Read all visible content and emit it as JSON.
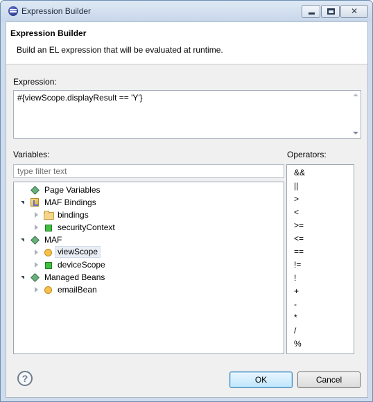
{
  "window": {
    "title": "Expression Builder"
  },
  "header": {
    "title": "Expression Builder",
    "description": "Build an EL expression that will be evaluated at runtime."
  },
  "expression": {
    "label": "Expression:",
    "value": "#{viewScope.displayResult == 'Y'}"
  },
  "variables": {
    "label": "Variables:",
    "filter_placeholder": "type filter text",
    "tree": [
      {
        "label": "Page Variables",
        "icon": "diamond-icon",
        "state": "leaf"
      },
      {
        "label": "MAF Bindings",
        "icon": "maf-icon",
        "state": "expanded"
      },
      {
        "label": "bindings",
        "icon": "folder-icon",
        "state": "collapsed"
      },
      {
        "label": "securityContext",
        "icon": "green-square-icon",
        "state": "collapsed"
      },
      {
        "label": "MAF",
        "icon": "diamond-icon",
        "state": "expanded"
      },
      {
        "label": "viewScope",
        "icon": "bean-icon",
        "state": "collapsed",
        "selected": true
      },
      {
        "label": "deviceScope",
        "icon": "green-square-icon",
        "state": "collapsed"
      },
      {
        "label": "Managed Beans",
        "icon": "diamond-icon",
        "state": "expanded"
      },
      {
        "label": "emailBean",
        "icon": "bean-icon",
        "state": "collapsed"
      }
    ]
  },
  "operators": {
    "label": "Operators:",
    "items": [
      "&&",
      "||",
      ">",
      "<",
      ">=",
      "<=",
      "==",
      "!=",
      "!",
      "+",
      "-",
      "*",
      "/",
      "%"
    ]
  },
  "buttons": {
    "ok": "OK",
    "cancel": "Cancel"
  }
}
